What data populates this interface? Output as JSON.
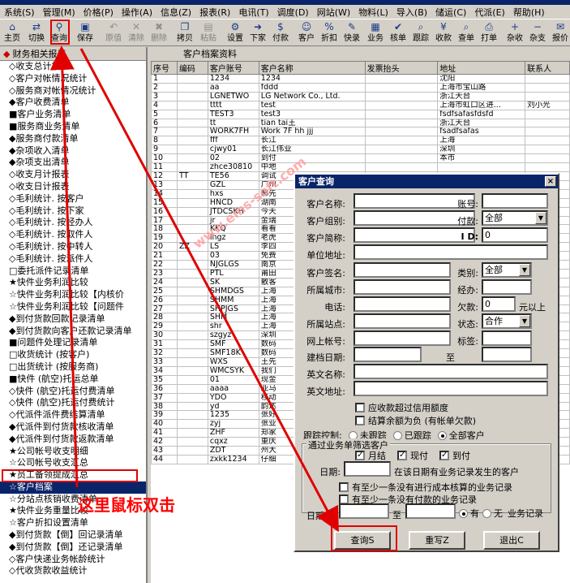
{
  "menu": [
    "系统(S)",
    "管理(M)",
    "价格(P)",
    "操作(A)",
    "信息(Z)",
    "报表(R)",
    "电讯(T)",
    "调度(D)",
    "网站(W)",
    "物料(L)",
    "导入(B)",
    "储运(C)",
    "代派(E)",
    "帮助(H)"
  ],
  "toolbar": [
    {
      "label": "主页",
      "icon": "home-icon",
      "enabled": true
    },
    {
      "label": "切换",
      "icon": "switch-icon",
      "enabled": true
    },
    {
      "label": "查询",
      "icon": "binoculars-icon",
      "enabled": true
    },
    {
      "label": "保存",
      "icon": "save-icon",
      "enabled": true
    },
    {
      "label": "原值",
      "icon": "undo-icon",
      "enabled": false
    },
    {
      "label": "清除",
      "icon": "clear-icon",
      "enabled": false
    },
    {
      "label": "删除",
      "icon": "delete-icon",
      "enabled": false
    },
    {
      "label": "拷贝",
      "icon": "copy-icon",
      "enabled": true
    },
    {
      "label": "粘贴",
      "icon": "paste-icon",
      "enabled": false
    },
    {
      "label": "设置",
      "icon": "settings-icon",
      "enabled": true
    },
    {
      "label": "下家",
      "icon": "next-icon",
      "enabled": true
    },
    {
      "label": "付款",
      "icon": "payment-icon",
      "enabled": true
    },
    {
      "label": "客户",
      "icon": "customer-icon",
      "enabled": true
    },
    {
      "label": "折扣",
      "icon": "discount-icon",
      "enabled": true
    },
    {
      "label": "快录",
      "icon": "quick-entry-icon",
      "enabled": true
    },
    {
      "label": "业务",
      "icon": "business-icon",
      "enabled": true
    },
    {
      "label": "核单",
      "icon": "verify-icon",
      "enabled": true
    },
    {
      "label": "跟踪",
      "icon": "track-icon",
      "enabled": true
    },
    {
      "label": "收款",
      "icon": "receive-icon",
      "enabled": true
    },
    {
      "label": "查单",
      "icon": "search-order-icon",
      "enabled": true
    },
    {
      "label": "打单",
      "icon": "print-icon",
      "enabled": true
    },
    {
      "label": "杂收",
      "icon": "misc-income-icon",
      "enabled": true
    },
    {
      "label": "杂支",
      "icon": "misc-expense-icon",
      "enabled": true
    },
    {
      "label": "报价",
      "icon": "quote-icon",
      "enabled": true
    }
  ],
  "left_panel": {
    "title": "财务相关报表",
    "items": [
      "◇收支总计报表",
      "◇客户对帐情况统计",
      "◇服务商对帐情况统计",
      "◆客户收费清单",
      "■客户业务清单",
      "■服务商业务清单",
      "◆服务商付款清单",
      "◆杂项收入清单",
      "◆杂项支出清单",
      "◇收支月计报表",
      "◇收支日计报表",
      "◇毛利统计. 按客户",
      "◇毛利统计. 按下家",
      "◇毛利统计. 按经办人",
      "◇毛利统计. 按取件人",
      "◇毛利统计. 按中转人",
      "◇毛利统计. 按派件人",
      "□委托派件记录清单",
      "★快件业务利润比较",
      "☆快件业务利润比较【内核价",
      "☆快件业务利润比较【问题件",
      "◆到付货款回款记录清单",
      "◆到付货款向客户还款记录清单",
      "■问题件处理记录清单",
      "□收货统计 (按客户)",
      "□出货统计 (按服务商)",
      "■快件 (航空)托运总单",
      "◇快件 (航空)托运付费清单",
      "◇快件 (航空)托运付费统计",
      "◇代派件派件费结算清单",
      "◆代派件到付货款核收清单",
      "◆代派件到付货款返款清单",
      "★公司帐号收支明细",
      "☆公司帐号收支汇总",
      "★员工备领提成汇总",
      "☆客户档案",
      "☆分站点核销收费清单",
      "★快件业务重量比较",
      "☆客户折扣设置清单",
      "◆到付货款【倒】回记录清单",
      "◆到付货款【倒】还记录清单",
      "◇客户快递业务帐龄统计",
      "◇代收货款收益统计"
    ],
    "selected_index": 35
  },
  "grid": {
    "title": "客户档案资料",
    "columns": [
      "序号",
      "编码",
      "客户账号",
      "客户名称",
      "发票抬头",
      "地址",
      "联系人"
    ],
    "rows": [
      [
        "1",
        "",
        "1234",
        "1234",
        "",
        "沈阳",
        ""
      ],
      [
        "2",
        "",
        "aa",
        "fddd",
        "",
        "上海市宝山路",
        ""
      ],
      [
        "3",
        "",
        "LGNETWO",
        "LG Network Co., Ltd.",
        "",
        "浙江天台",
        ""
      ],
      [
        "4",
        "",
        "tttt",
        "test",
        "",
        "上海市虹口区进...",
        "刘小光"
      ],
      [
        "5",
        "",
        "TEST3",
        "test3",
        "",
        "fsdfsafasfdsfd",
        ""
      ],
      [
        "6",
        "",
        "tt",
        "tian tai王",
        "",
        "浙江天台",
        ""
      ],
      [
        "7",
        "",
        "WORK7FH",
        "Work 7F hh jjj",
        "",
        "fsadfsafas",
        ""
      ],
      [
        "8",
        "",
        "fff",
        "长江",
        "",
        "上海",
        ""
      ],
      [
        "9",
        "",
        "cjwy01",
        "长江伟业",
        "",
        "深圳",
        ""
      ],
      [
        "10",
        "",
        "02",
        "到付",
        "",
        "本市",
        ""
      ],
      [
        "11",
        "",
        "zhce30810",
        "中地",
        "",
        "",
        ""
      ],
      [
        "12",
        "TT",
        "TE56",
        "调试",
        "",
        "",
        ""
      ],
      [
        "13",
        "",
        "GZL",
        "广州",
        "",
        "",
        ""
      ],
      [
        "14",
        "",
        "hxs",
        "郝先",
        "",
        "",
        ""
      ],
      [
        "15",
        "",
        "HNCD",
        "湖南",
        "",
        "",
        ""
      ],
      [
        "16",
        "",
        "JTDCSKH",
        "今天",
        "",
        "",
        ""
      ],
      [
        "17",
        "",
        "jr",
        "金瑞",
        "",
        "",
        ""
      ],
      [
        "18",
        "",
        "KKQ",
        "看看",
        "",
        "",
        ""
      ],
      [
        "19",
        "",
        "lhgz",
        "老虎",
        "",
        "",
        ""
      ],
      [
        "20",
        "ZZ",
        "LS",
        "李四",
        "",
        "",
        ""
      ],
      [
        "21",
        "",
        "03",
        "免费",
        "",
        "",
        ""
      ],
      [
        "22",
        "",
        "NJGLGS",
        "南京",
        "",
        "",
        ""
      ],
      [
        "23",
        "",
        "PTL",
        "莆田",
        "",
        "",
        ""
      ],
      [
        "24",
        "",
        "SK",
        "散客",
        "",
        "",
        ""
      ],
      [
        "25",
        "",
        "SHMDGS",
        "上海",
        "",
        "",
        ""
      ],
      [
        "26",
        "",
        "SHMM",
        "上海",
        "",
        "",
        ""
      ],
      [
        "27",
        "",
        "SHPJGS",
        "上海",
        "",
        "",
        ""
      ],
      [
        "28",
        "",
        "SHM",
        "上海",
        "",
        "",
        ""
      ],
      [
        "29",
        "",
        "shr",
        "上海",
        "",
        "",
        ""
      ],
      [
        "30",
        "",
        "szgyz",
        "深圳",
        "",
        "",
        ""
      ],
      [
        "31",
        "",
        "SMF",
        "数码",
        "",
        "",
        ""
      ],
      [
        "32",
        "",
        "SMF18K",
        "数码",
        "",
        "",
        ""
      ],
      [
        "33",
        "",
        "WXS",
        "王先",
        "",
        "",
        ""
      ],
      [
        "34",
        "",
        "WMCSYK",
        "我们",
        "",
        "",
        ""
      ],
      [
        "35",
        "",
        "01",
        "现金",
        "",
        "",
        ""
      ],
      [
        "36",
        "",
        "aaaa",
        "亚马",
        "",
        "",
        ""
      ],
      [
        "37",
        "",
        "YDO",
        "移动",
        "",
        "",
        ""
      ],
      [
        "38",
        "",
        "yd",
        "韵达",
        "",
        "",
        ""
      ],
      [
        "39",
        "",
        "1235",
        "张好",
        "",
        "",
        ""
      ],
      [
        "40",
        "",
        "zyj",
        "张业",
        "",
        "",
        ""
      ],
      [
        "41",
        "",
        "ZHF",
        "郑家",
        "",
        "",
        ""
      ],
      [
        "42",
        "",
        "cqxz",
        "重庆",
        "",
        "",
        ""
      ],
      [
        "43",
        "",
        "ZDT",
        "州大",
        "",
        "",
        ""
      ],
      [
        "44",
        "",
        "zxkk1234",
        "仔细",
        "",
        "",
        ""
      ]
    ]
  },
  "dialog": {
    "title": "客户查询",
    "close": "×",
    "labels": {
      "name": "客户名称:",
      "account": "账号:",
      "group": "客户组别:",
      "payment": "付款:",
      "short": "客户简称:",
      "id": "I D:",
      "unit_addr": "单位地址:",
      "sign": "客户签名:",
      "category": "类别:",
      "city": "所属城市:",
      "handler": "经办:",
      "phone": "电话:",
      "owed": "欠款:",
      "owed_unit": "元以上",
      "site": "所属站点:",
      "status": "状态:",
      "web_account": "网上帐号:",
      "tag": "标签:",
      "created": "建档日期:",
      "to": "至",
      "en_name": "英文名称:",
      "en_addr": "英文地址:"
    },
    "values": {
      "payment": "全部",
      "id": "0",
      "category": "全部",
      "owed": "0",
      "status": "合作"
    },
    "checkboxes": {
      "credit": "应收款超过信用额度",
      "settle_negative": "结算余额为负 (有帐单欠款)"
    },
    "follow": {
      "label": "跟踪控制:",
      "options": [
        "未跟踪",
        "已跟踪",
        "全部客户"
      ],
      "selected": 2
    },
    "group_box": {
      "title": "通过业务单筛选客户",
      "pay_types": [
        "月结",
        "现付",
        "到付"
      ],
      "date_label": "日期:",
      "date_hint": "在该日期有业务记录发生的客户",
      "no_cost": "有至少一条没有进行成本核算的业务记录",
      "has_payment": "有至少一条没有付款的业务记录"
    },
    "date_row": {
      "label": "日期",
      "to": "至",
      "options": [
        "有",
        "无"
      ],
      "selected": 0,
      "suffix": "业务记录"
    },
    "buttons": {
      "query": "查询S",
      "reset": "重写Z",
      "exit": "退出C"
    }
  },
  "annotation": {
    "text": "这里鼠标双击",
    "color": "#ff0000"
  },
  "watermark": "www.ems-soft.com"
}
